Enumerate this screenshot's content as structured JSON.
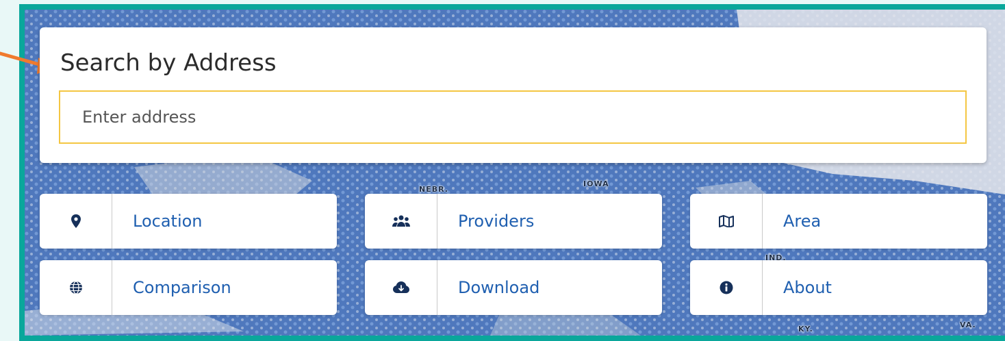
{
  "search": {
    "title": "Search by Address",
    "placeholder": "Enter address"
  },
  "nav": [
    {
      "label": "Location",
      "icon": "map-marker-icon"
    },
    {
      "label": "Providers",
      "icon": "users-icon"
    },
    {
      "label": "Area",
      "icon": "map-icon"
    },
    {
      "label": "Comparison",
      "icon": "globe-icon"
    },
    {
      "label": "Download",
      "icon": "cloud-download-icon"
    },
    {
      "label": "About",
      "icon": "info-circle-icon"
    }
  ],
  "map": {
    "labels": [
      "NEBR.",
      "IOWA",
      "IND.",
      "KY.",
      "VA."
    ]
  },
  "colors": {
    "frame": "#0aa79b",
    "map_fill": "#4f78bd",
    "input_border": "#f4c642",
    "link_text": "#1f5fb0",
    "arrow": "#f07a2e"
  }
}
